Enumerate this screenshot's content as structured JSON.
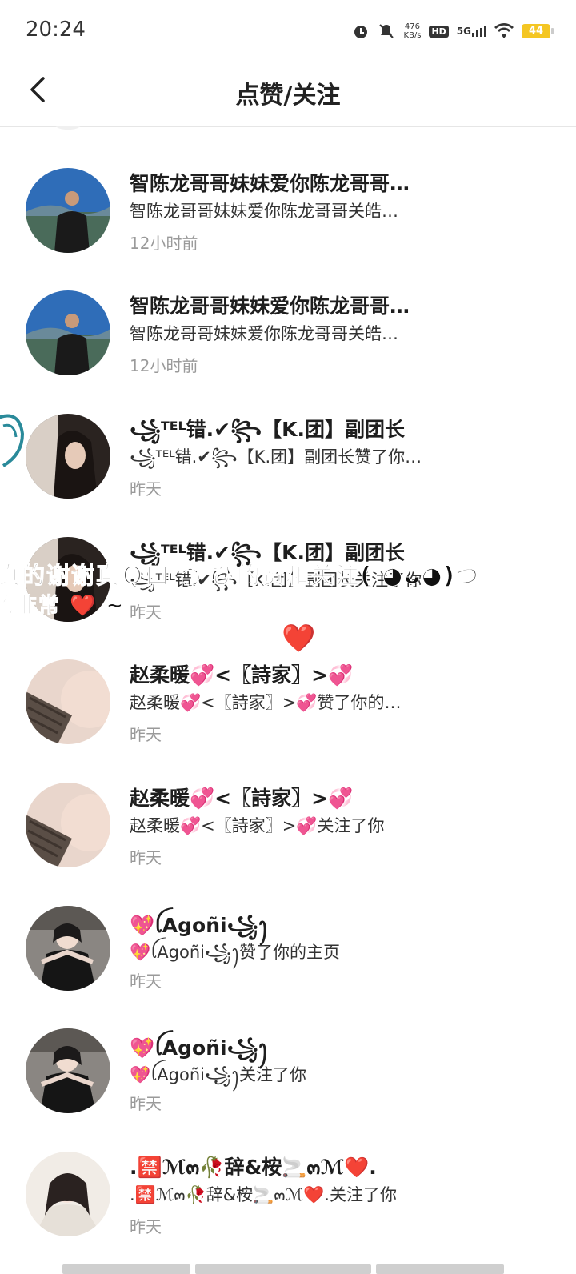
{
  "status_bar": {
    "time": "20:24",
    "net_speed_value": "476",
    "net_speed_unit": "KB/s",
    "hd": "HD",
    "network": "5G",
    "battery": "44",
    "icons": [
      "alarm-icon",
      "mute-icon",
      "signal-icon",
      "wifi-icon",
      "battery-icon"
    ]
  },
  "header": {
    "title": "点赞/关注",
    "back_icon": "chevron-left-icon"
  },
  "items": [
    {
      "name": "智陈龙哥哥妹妹爱你陈龙哥哥…",
      "desc": "智陈龙哥哥妹妹爱你陈龙哥哥关皓…",
      "time": "12小时前",
      "avatar": "man-landscape"
    },
    {
      "name": "智陈龙哥哥妹妹爱你陈龙哥哥…",
      "desc": "智陈龙哥哥妹妹爱你陈龙哥哥关皓…",
      "time": "12小时前",
      "avatar": "man-landscape"
    },
    {
      "name": "꧁ᵀᴱᴸ错.✔︎꧂【K.团】副团长",
      "desc": "꧁ᵀᴱᴸ错.✔︎꧂【K.团】副团长赞了你…",
      "time": "昨天",
      "avatar": "woman-dark"
    },
    {
      "name": "꧁ᵀᴱᴸ错.✔︎꧂【K.团】副团长",
      "desc": "꧁ᵀᴱᴸ错.✔︎꧂【K.团】副团长关注了你",
      "time": "昨天",
      "avatar": "woman-dark"
    },
    {
      "name": "赵柔暖💞<〖詩家〗>💞",
      "desc": "赵柔暖💞<〖詩家〗>💞赞了你的…",
      "time": "昨天",
      "avatar": "sweater"
    },
    {
      "name": "赵柔暖💞<〖詩家〗>💞",
      "desc": "赵柔暖💞<〖詩家〗>💞关注了你",
      "time": "昨天",
      "avatar": "sweater"
    },
    {
      "name": "💖ꪶAgoñi꧁ꫂ",
      "desc": "💖ꪶAgoñi꧁ꫂ赞了你的主页",
      "time": "昨天",
      "avatar": "girl-pose"
    },
    {
      "name": "💖ꪶAgoñi꧁ꫂ",
      "desc": "💖ꪶAgoñi꧁ꫂ关注了你",
      "time": "昨天",
      "avatar": "girl-pose"
    },
    {
      "name": ".🈲ℳ๓🥀辞&桉🚬๓ℳ❤️.",
      "desc": ".🈲ℳ๓🥀辞&桉🚬๓ℳ❤️.关注了你",
      "time": "昨天",
      "avatar": "girl-light"
    }
  ],
  "overlay": {
    "line1": "真的谢谢真Ｑ口 ◌ ぴ的赞和关注( ◕ᴗ◕)づ",
    "line2": "的非常 ❤️ ~",
    "heart": "❤️"
  }
}
